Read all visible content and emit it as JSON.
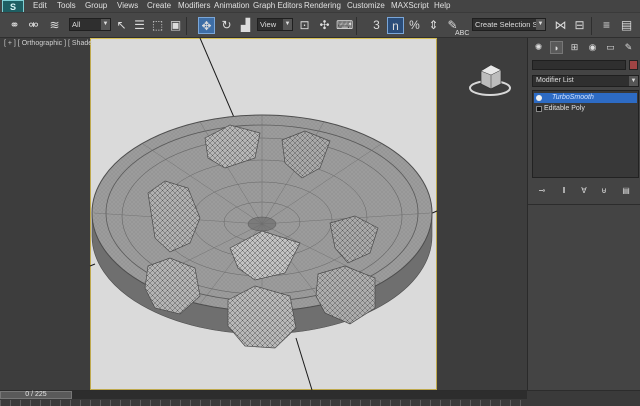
{
  "app": {
    "logo_letter": "S"
  },
  "menu": [
    "Edit",
    "Tools",
    "Group",
    "Views",
    "Create",
    "Modifiers",
    "Animation",
    "Graph Editors",
    "Rendering",
    "Customize",
    "MAXScript",
    "Help"
  ],
  "toolbar": {
    "selection_filter": "All",
    "reference_coord": "View",
    "snap_value": "3",
    "snap_angle_label": "n",
    "named_selection": "Create Selection Se",
    "abc_label": "ABC"
  },
  "viewport": {
    "label": "[ + ] [ Orthographic ] [ Shade"
  },
  "command_panel": {
    "modifier_list": "Modifier List",
    "stack": [
      {
        "label": "TurboSmooth",
        "selected": true
      },
      {
        "label": "Editable Poly",
        "selected": false
      }
    ]
  },
  "timeline": {
    "frame_indicator": "0 / 225"
  },
  "colors": {
    "viewport_bg": "#3d3d3d",
    "safe_frame_bg": "#dadada",
    "selected_modifier": "#2d6bc4",
    "active_tool": "#3e6ea6",
    "mesh_line": "#5a5a5a"
  }
}
